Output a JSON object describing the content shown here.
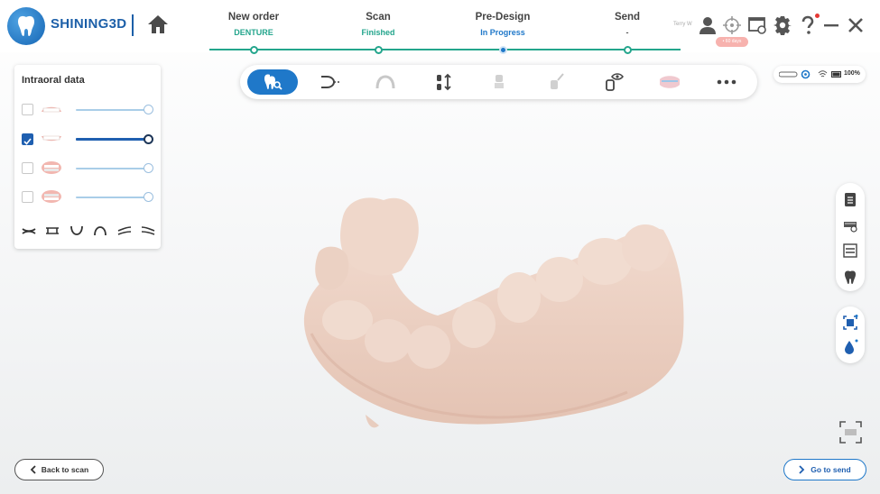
{
  "app": {
    "brand": "SHINING3D"
  },
  "workflow": {
    "steps": [
      {
        "title": "New order",
        "status": "DENTURE",
        "status_color": "#23a58c"
      },
      {
        "title": "Scan",
        "status": "Finished",
        "status_color": "#23a58c"
      },
      {
        "title": "Pre-Design",
        "status": "In Progress",
        "status_color": "#1f78c9"
      },
      {
        "title": "Send",
        "status": "-",
        "status_color": "#555555"
      }
    ]
  },
  "header": {
    "user_name": "Terry W",
    "badge_text": "• 60 days",
    "icons": [
      "user-icon",
      "target-icon",
      "screen-settings-icon",
      "gear-icon",
      "help-icon",
      "minimize-icon",
      "close-icon"
    ]
  },
  "left_panel": {
    "title": "Intraoral data",
    "layers": [
      {
        "name": "upper-jaw",
        "checked": false,
        "opacity": 1.0
      },
      {
        "name": "lower-jaw",
        "checked": true,
        "opacity": 1.0
      },
      {
        "name": "upper-bite",
        "checked": false,
        "opacity": 1.0
      },
      {
        "name": "lower-bite",
        "checked": false,
        "opacity": 1.0
      }
    ],
    "view_icons": [
      "view-front-icon",
      "view-back-icon",
      "view-bottom-icon",
      "view-top-icon",
      "view-left-icon",
      "view-right-icon"
    ]
  },
  "toolbar": {
    "tools": [
      "tooth-select-icon",
      "trim-icon",
      "arch-icon",
      "align-icon",
      "die-icon",
      "brush-icon",
      "visibility-icon",
      "occlusion-icon",
      "more-icon"
    ],
    "active_tool": "tooth-select-icon"
  },
  "device_status": {
    "battery": "100%"
  },
  "footer": {
    "back_label": "Back to scan",
    "send_label": "Go to send"
  },
  "colors": {
    "accent": "#1f78c9",
    "progress": "#23a58c",
    "model": "#f0d6c8"
  }
}
